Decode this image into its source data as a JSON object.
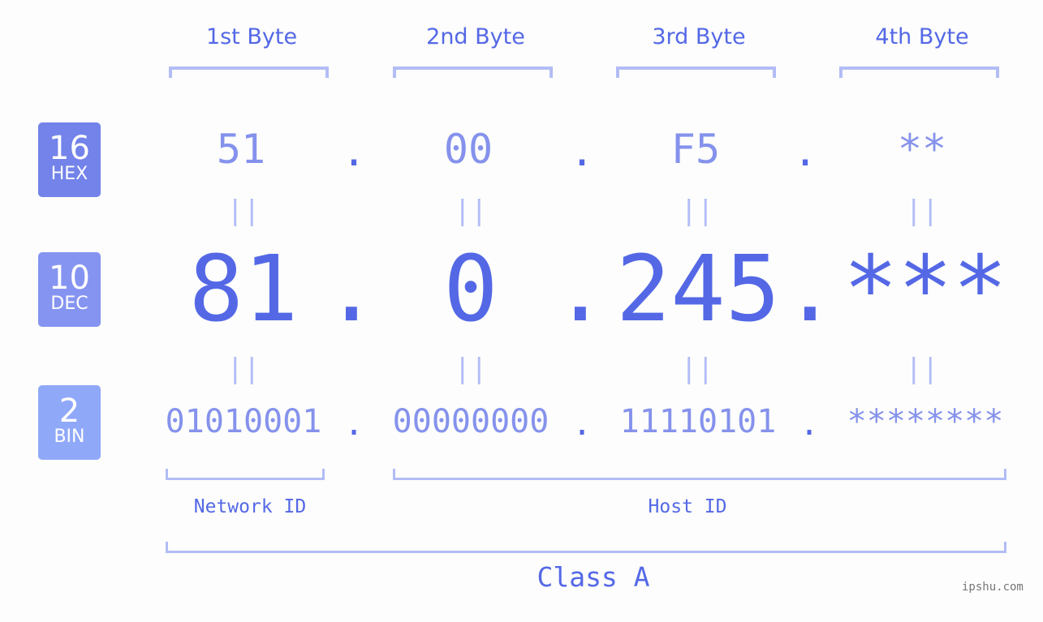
{
  "byte_headers": [
    "1st Byte",
    "2nd Byte",
    "3rd Byte",
    "4th Byte"
  ],
  "badges": {
    "hex": {
      "number": "16",
      "label": "HEX",
      "color": "#7383ea"
    },
    "dec": {
      "number": "10",
      "label": "DEC",
      "color": "#8594f0"
    },
    "bin": {
      "number": "2",
      "label": "BIN",
      "color": "#90a8f8"
    }
  },
  "hex": [
    "51",
    "00",
    "F5",
    "**"
  ],
  "dec": [
    "81",
    "0",
    "245",
    "***"
  ],
  "bin": [
    "01010001",
    "00000000",
    "11110101",
    "********"
  ],
  "separator": ".",
  "equals": "||",
  "network_id_label": "Network ID",
  "host_id_label": "Host ID",
  "class_label": "Class A",
  "watermark": "ipshu.com",
  "colors": {
    "accent": "#5468e6",
    "light_accent": "#8592ec",
    "bracket": "#b2bdf6",
    "background": "#fcfdfc"
  }
}
